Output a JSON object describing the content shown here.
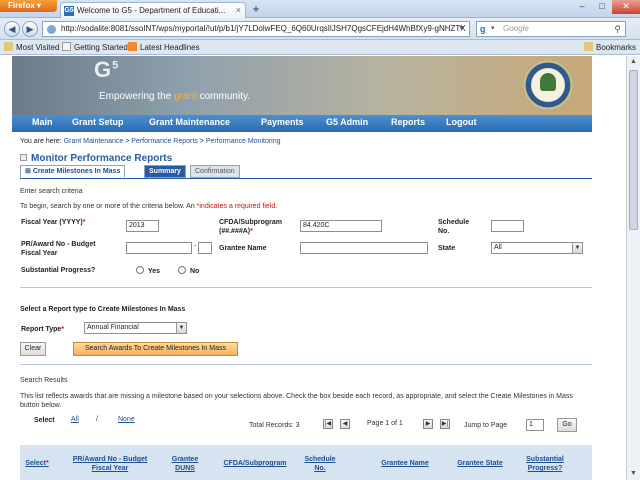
{
  "browser": {
    "app_button": "Firefox",
    "tab_title": "Welcome to G5 - Department of Educati...",
    "favicon_text": "G5",
    "url": "http://sodalite:8081/ssoINT/wps/myportal/!ut/p/b1/jY7LDolwFEQ_6Q60UrqsIlJSH7QgsCFEjdH4WhBfXy9-gNHZTX",
    "search_placeholder": "Google",
    "bookmarks": [
      "Most Visited",
      "Getting Started",
      "Latest Headlines"
    ],
    "bookmarks_menu": "Bookmarks"
  },
  "banner": {
    "logo": "G",
    "logo_sup": "5",
    "tagline_prefix": "Empowering the ",
    "tagline_highlight": "grant",
    "tagline_suffix": " community."
  },
  "main_nav": [
    "Main",
    "Grant Setup",
    "Grant Maintenance",
    "Payments",
    "G5 Admin",
    "Reports",
    "Logout"
  ],
  "breadcrumb": {
    "prefix": "You are here:",
    "items": [
      "Grant Maintenance",
      "Performance Reports",
      "Performance Monitoring"
    ],
    "sep": ">"
  },
  "page_title": "Monitor Performance Reports",
  "tabs": [
    "Create Milestones In Mass",
    "Summary",
    "Confirmation"
  ],
  "criteria": {
    "heading": "Enter search criteria",
    "instructions_a": "To begin, search by one or more of the criteria below.  An ",
    "instructions_b": "*indicates a required field.",
    "fiscal_year_label": "Fiscal Year (YYYY)",
    "fiscal_year_value": "2013",
    "cfda_label": "CFDA/Subprogram (##.###A)",
    "cfda_value": "84.420C",
    "schedule_label": "Schedule No.",
    "schedule_value": "",
    "pr_award_label": "PR/Award No - Budget Fiscal Year",
    "pr_award_value": "",
    "pr_award_sep": "-",
    "budget_fy_value": "",
    "grantee_label": "Grantee Name",
    "grantee_value": "",
    "state_label": "State",
    "state_value": "All",
    "substantial_label": "Substantial Progress?",
    "yes": "Yes",
    "no": "No",
    "asterisk": "*"
  },
  "report_type": {
    "heading": "Select a Report type to Create Milestones In Mass",
    "label": "Report Type",
    "value": "Annual Financial",
    "clear_button": "Clear",
    "search_button": "Search Awards To Create Milestones In Mass"
  },
  "results": {
    "heading": "Search Results",
    "description": "This list reflects awards that are missing a milestone based on your selections above. Check the box beside each record, as appropriate, and select the Create Milestones in Mass button below.",
    "select_label": "Select",
    "all_link": "All",
    "sep": "/",
    "none_link": "None",
    "total_records": "Total Records: 3",
    "page_of": "Page 1 of 1",
    "jump_label": "Jump to Page",
    "jump_value": "1",
    "go_button": "Go",
    "columns": [
      "Select",
      "PR/Award No - Budget Fiscal Year",
      "Grantee DUNS",
      "CFDA/Subprogram",
      "Schedule No.",
      "Grantee Name",
      "Grantee State",
      "Substantial Progress?"
    ]
  }
}
